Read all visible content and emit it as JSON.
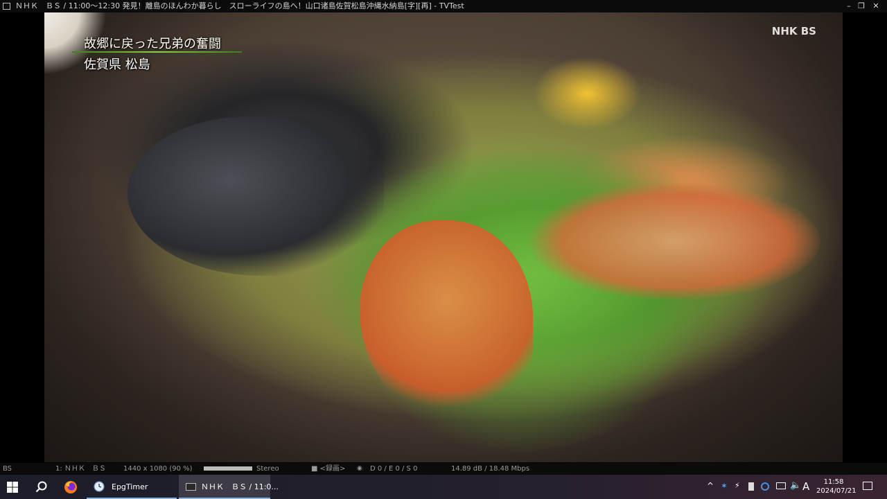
{
  "window": {
    "title": "ＮＨＫ　ＢＳ / 11:00～12:30 発見！離島のほんわか暮らし　スローライフの島へ！山口诸島佐賀松島沖縄水納島[字][再] - TVTest",
    "minimize": "–",
    "restore": "❐",
    "close": "✕"
  },
  "video": {
    "caption_line1": "故郷に戻った兄弟の奮闘",
    "caption_line2": "佐賀県 松島",
    "channel_logo": "NHK BS"
  },
  "status": {
    "tuner": "BS",
    "channel": "1: ＮＨＫ　ＢＳ",
    "resolution": "1440 x 1080 (90 %)",
    "volume_level": 1.0,
    "audio": "Stereo",
    "record": "■ <録画>",
    "errors": "D 0 / E 0 / S 0",
    "signal": "14.89 dB / 18.48 Mbps"
  },
  "taskbar": {
    "apps": [
      {
        "label": "EpgTimer"
      },
      {
        "label": "ＮＨＫ　ＢＳ / 11:0..."
      }
    ],
    "ime": "A",
    "clock_time": "11:58",
    "clock_date": "2024/07/21"
  }
}
